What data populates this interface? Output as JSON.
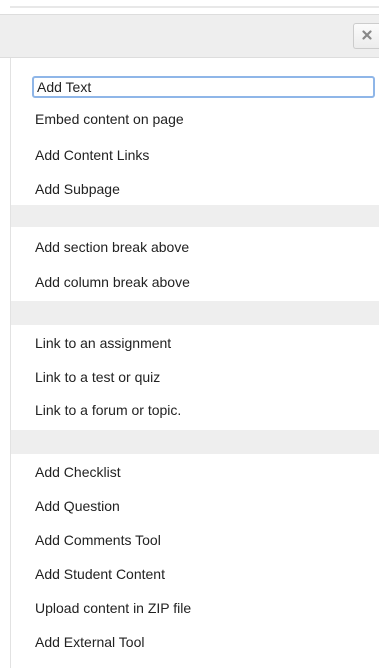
{
  "dialog": {
    "close_icon": "close-icon"
  },
  "menu": {
    "groups": [
      {
        "items": [
          "Add Text",
          "Embed content on page",
          "Add Content Links",
          "Add Subpage"
        ]
      },
      {
        "items": [
          "Add section break above",
          "Add column break above"
        ]
      },
      {
        "items": [
          "Link to an assignment",
          "Link to a test or quiz",
          "Link to a forum or topic."
        ]
      },
      {
        "items": [
          "Add Checklist",
          "Add Question",
          "Add Comments Tool",
          "Add Student Content",
          "Upload content in ZIP file",
          "Add External Tool"
        ]
      }
    ]
  },
  "colors": {
    "separator": "#eeeeee",
    "focus_ring": "#8fb6e8"
  }
}
